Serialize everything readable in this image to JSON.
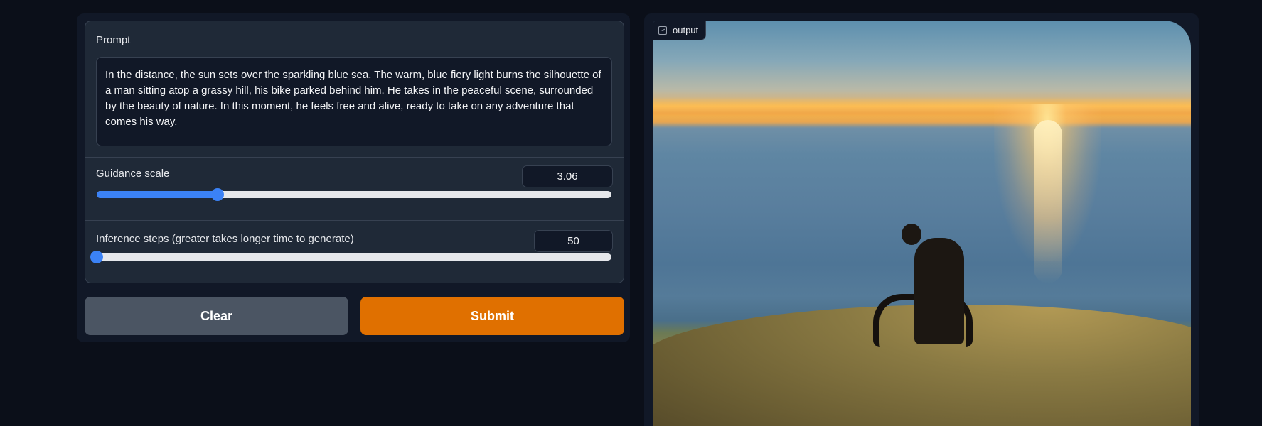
{
  "prompt": {
    "label": "Prompt",
    "value": "In the distance, the sun sets over the sparkling blue sea. The warm, blue fiery light burns the silhouette of a man sitting atop a grassy hill, his bike parked behind him. He takes in the peaceful scene, surrounded by the beauty of nature. In this moment, he feels free and alive, ready to take on any adventure that comes his way."
  },
  "guidance": {
    "label": "Guidance scale",
    "value": "3.06",
    "slider_fraction": 0.235
  },
  "steps": {
    "label": "Inference steps (greater takes longer time to generate)",
    "value": "50",
    "slider_fraction": 0.0
  },
  "buttons": {
    "clear_label": "Clear",
    "submit_label": "Submit"
  },
  "output": {
    "tag_label": "output",
    "tag_icon": "image-icon"
  },
  "colors": {
    "accent": "#3b82f6",
    "submit": "#e07000",
    "clear": "#4b5563"
  }
}
